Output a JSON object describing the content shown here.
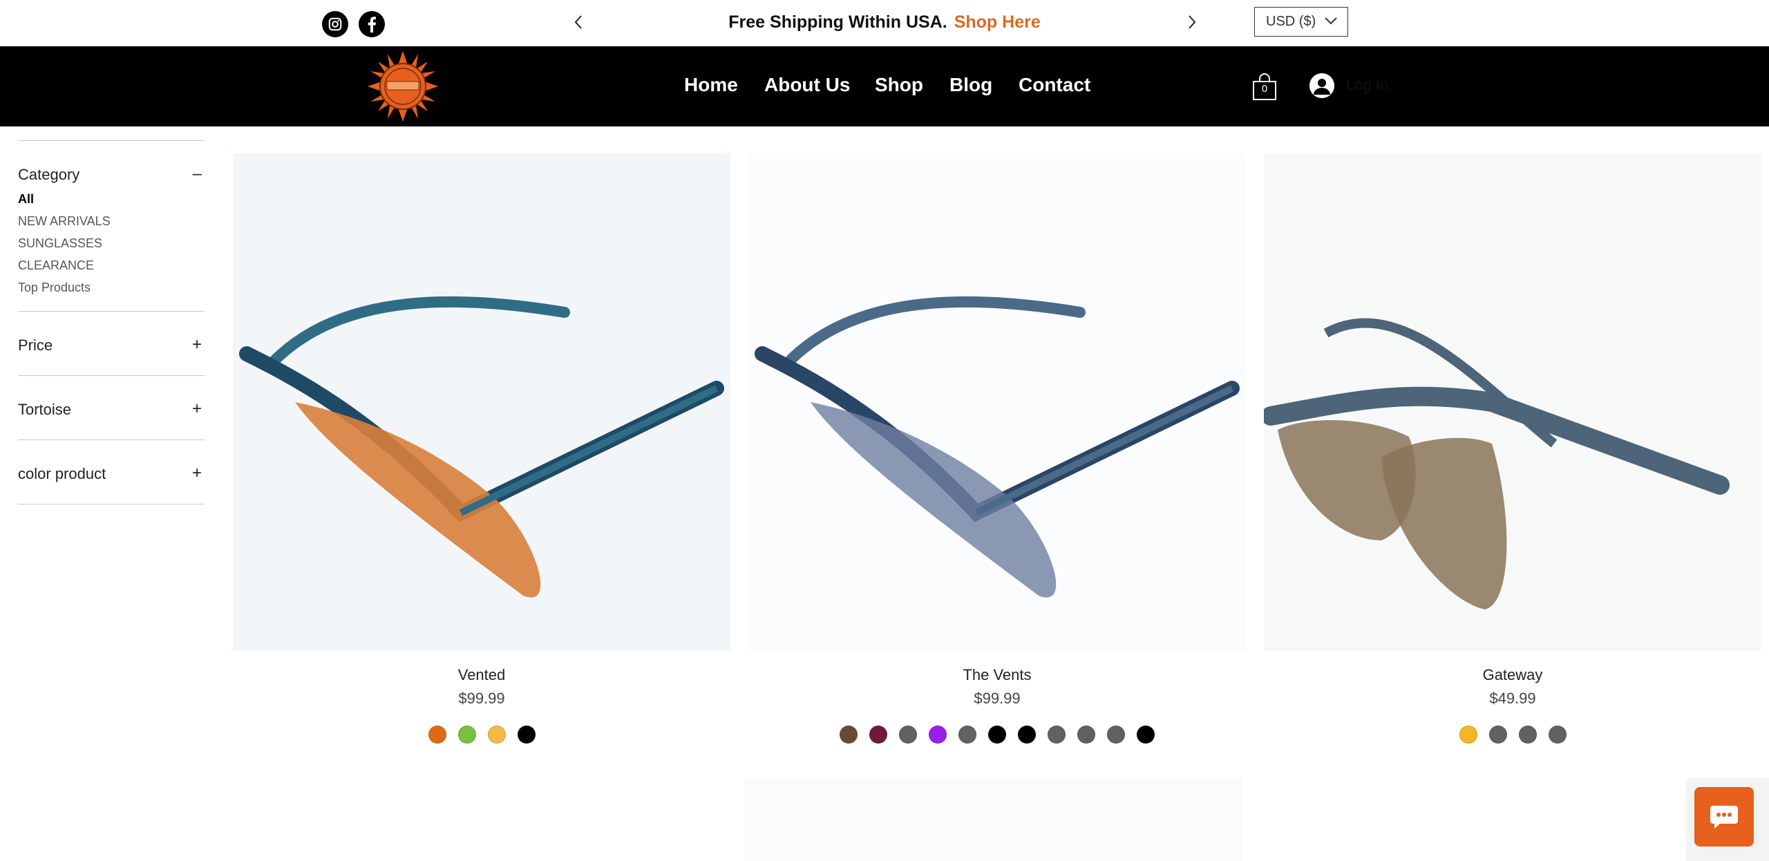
{
  "announcement": {
    "text": "Free Shipping Within USA.",
    "link": "Shop Here",
    "link_color": "#d96a1f"
  },
  "social": [
    {
      "name": "instagram-icon"
    },
    {
      "name": "facebook-icon"
    }
  ],
  "currency": {
    "label": "USD ($)"
  },
  "nav": {
    "items": [
      "Home",
      "About Us",
      "Shop",
      "Blog",
      "Contact"
    ]
  },
  "cart": {
    "count": "0"
  },
  "account": {
    "login_label": "Log In"
  },
  "filters": {
    "category": {
      "title": "Category",
      "toggle": "–",
      "items": [
        "All",
        "NEW ARRIVALS",
        "SUNGLASSES",
        "CLEARANCE",
        "Top Products"
      ]
    },
    "price": {
      "title": "Price",
      "toggle": "+"
    },
    "tortoise": {
      "title": "Tortoise",
      "toggle": "+"
    },
    "color_product": {
      "title": "color product",
      "toggle": "+"
    }
  },
  "products": [
    {
      "name": "Vented",
      "price": "$99.99",
      "swatches": [
        "#e06a14",
        "#7bbf3f",
        "#f7b84b",
        "#000000"
      ]
    },
    {
      "name": "The Vents",
      "price": "$99.99",
      "swatches": [
        "#6b4a35",
        "#6e1a3f",
        "#616161",
        "#9b1fe8",
        "#616161",
        "#000000",
        "#000000",
        "#616161",
        "#616161",
        "#616161",
        "#000000"
      ]
    },
    {
      "name": "Gateway",
      "price": "$49.99",
      "swatches": [
        "#f2b824",
        "#616161",
        "#616161",
        "#616161"
      ]
    }
  ],
  "colors": {
    "header_bg": "#000000",
    "accent": "#e6601e"
  }
}
